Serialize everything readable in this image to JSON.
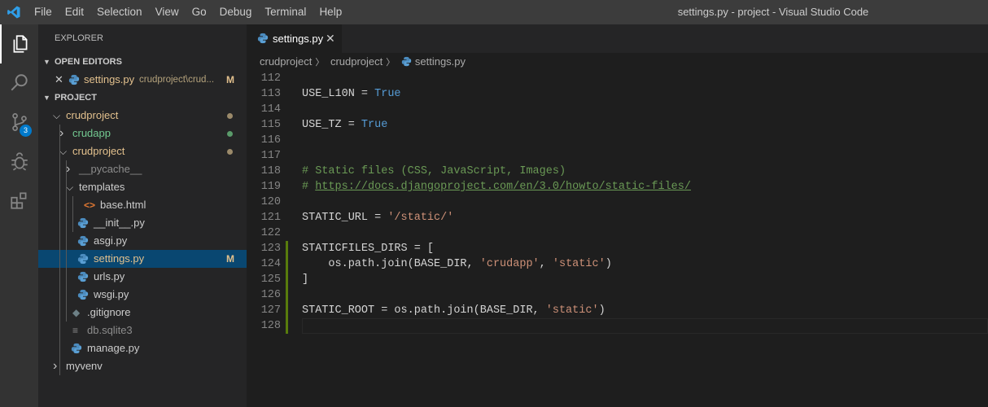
{
  "menu": [
    "File",
    "Edit",
    "Selection",
    "View",
    "Go",
    "Debug",
    "Terminal",
    "Help"
  ],
  "window_title": "settings.py - project - Visual Studio Code",
  "activity": {
    "scm_badge": "3"
  },
  "sidebar": {
    "title": "EXPLORER",
    "open_editors": {
      "header": "OPEN EDITORS",
      "item": {
        "name": "settings.py",
        "path": "crudproject\\crud...",
        "status": "M"
      }
    },
    "project_header": "PROJECT",
    "tree": [
      {
        "label": "crudproject",
        "kind": "folder-open",
        "depth": 0,
        "color": "#e2c08d",
        "dot": "#9b8a6a"
      },
      {
        "label": "crudapp",
        "kind": "folder-closed",
        "depth": 1,
        "color": "#73c991",
        "dot": "#5a9b6a"
      },
      {
        "label": "crudproject",
        "kind": "folder-open",
        "depth": 1,
        "color": "#e2c08d",
        "dot": "#9b8a6a"
      },
      {
        "label": "__pycache__",
        "kind": "folder-closed",
        "depth": 2,
        "color": "#8c8c8c"
      },
      {
        "label": "templates",
        "kind": "folder-open",
        "depth": 2,
        "color": "#cccccc"
      },
      {
        "label": "base.html",
        "kind": "html",
        "depth": 3,
        "color": "#cccccc"
      },
      {
        "label": "__init__.py",
        "kind": "py",
        "depth": 2,
        "color": "#cccccc"
      },
      {
        "label": "asgi.py",
        "kind": "py",
        "depth": 2,
        "color": "#cccccc"
      },
      {
        "label": "settings.py",
        "kind": "py",
        "depth": 2,
        "color": "#e2c08d",
        "mark": "M",
        "selected": true
      },
      {
        "label": "urls.py",
        "kind": "py",
        "depth": 2,
        "color": "#cccccc"
      },
      {
        "label": "wsgi.py",
        "kind": "py",
        "depth": 2,
        "color": "#cccccc"
      },
      {
        "label": ".gitignore",
        "kind": "git",
        "depth": 1,
        "color": "#cccccc"
      },
      {
        "label": "db.sqlite3",
        "kind": "db",
        "depth": 1,
        "color": "#8c8c8c"
      },
      {
        "label": "manage.py",
        "kind": "py",
        "depth": 1,
        "color": "#cccccc"
      },
      {
        "label": "myvenv",
        "kind": "folder-closed",
        "depth": 0,
        "color": "#cccccc"
      }
    ]
  },
  "tab": {
    "label": "settings.py",
    "close": "✕"
  },
  "breadcrumb": [
    "crudproject",
    "crudproject",
    "settings.py"
  ],
  "code_lines": [
    {
      "n": "112",
      "tokens": []
    },
    {
      "n": "113",
      "tokens": [
        [
          "",
          "USE_L10N = "
        ],
        [
          "kw",
          "True"
        ]
      ]
    },
    {
      "n": "114",
      "tokens": []
    },
    {
      "n": "115",
      "tokens": [
        [
          "",
          "USE_TZ = "
        ],
        [
          "kw",
          "True"
        ]
      ]
    },
    {
      "n": "116",
      "tokens": []
    },
    {
      "n": "117",
      "tokens": []
    },
    {
      "n": "118",
      "tokens": [
        [
          "cmt",
          "# Static files (CSS, JavaScript, Images)"
        ]
      ]
    },
    {
      "n": "119",
      "tokens": [
        [
          "cmt",
          "# "
        ],
        [
          "lnk",
          "https://docs.djangoproject.com/en/3.0/howto/static-files/"
        ]
      ]
    },
    {
      "n": "120",
      "tokens": []
    },
    {
      "n": "121",
      "tokens": [
        [
          "",
          "STATIC_URL = "
        ],
        [
          "str",
          "'/static/'"
        ]
      ]
    },
    {
      "n": "122",
      "tokens": []
    },
    {
      "n": "123",
      "mod": true,
      "tokens": [
        [
          "",
          "STATICFILES_DIRS = ["
        ]
      ]
    },
    {
      "n": "124",
      "mod": true,
      "tokens": [
        [
          "",
          "    os.path.join(BASE_DIR, "
        ],
        [
          "str",
          "'crudapp'"
        ],
        [
          "",
          ", "
        ],
        [
          "str",
          "'static'"
        ],
        [
          "",
          ")"
        ]
      ]
    },
    {
      "n": "125",
      "mod": true,
      "tokens": [
        [
          "",
          "]"
        ]
      ]
    },
    {
      "n": "126",
      "mod": true,
      "tokens": []
    },
    {
      "n": "127",
      "mod": true,
      "tokens": [
        [
          "",
          "STATIC_ROOT = os.path.join(BASE_DIR, "
        ],
        [
          "str",
          "'static'"
        ],
        [
          "",
          ")"
        ]
      ]
    },
    {
      "n": "128",
      "mod": true,
      "cursor": true,
      "tokens": []
    }
  ]
}
